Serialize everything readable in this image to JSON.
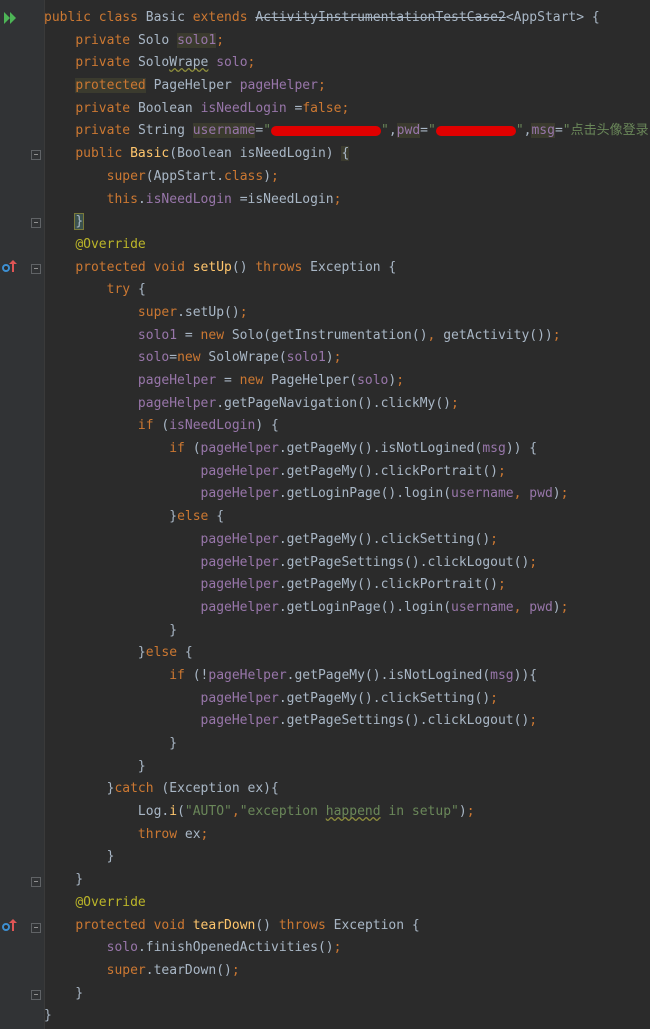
{
  "code_lines": [
    [
      {
        "t": "public ",
        "c": "kw"
      },
      {
        "t": "class ",
        "c": "kw"
      },
      {
        "t": "Basic "
      },
      {
        "t": "extends ",
        "c": "kw"
      },
      {
        "t": "ActivityInstrumentationTestCase2",
        "c": "strike"
      },
      {
        "t": "<AppStart> {"
      }
    ],
    [
      {
        "t": "    "
      },
      {
        "t": "private ",
        "c": "kw"
      },
      {
        "t": "Solo "
      },
      {
        "t": "solo1",
        "c": "fld hl"
      },
      {
        "t": ";",
        "c": "kw"
      }
    ],
    [
      {
        "t": "    "
      },
      {
        "t": "private ",
        "c": "kw"
      },
      {
        "t": "Solo"
      },
      {
        "t": "Wrape",
        "c": "warn"
      },
      {
        "t": " "
      },
      {
        "t": "solo",
        "c": "fld"
      },
      {
        "t": ";",
        "c": "kw"
      }
    ],
    [
      {
        "t": "    "
      },
      {
        "t": "protected",
        "c": "kw hl"
      },
      {
        "t": " PageHelper "
      },
      {
        "t": "pageHelper",
        "c": "fld"
      },
      {
        "t": ";",
        "c": "kw"
      }
    ],
    [
      {
        "t": "    "
      },
      {
        "t": "private ",
        "c": "kw"
      },
      {
        "t": "Boolean "
      },
      {
        "t": "isNeedLogin ",
        "c": "fld"
      },
      {
        "t": "="
      },
      {
        "t": "false",
        "c": "kw"
      },
      {
        "t": ";",
        "c": "kw"
      }
    ],
    [
      {
        "t": "    "
      },
      {
        "t": "private ",
        "c": "kw"
      },
      {
        "t": "String "
      },
      {
        "t": "username",
        "c": "fld hl"
      },
      {
        "t": "="
      },
      {
        "t": "\"",
        "c": "str"
      },
      {
        "blur": 110
      },
      {
        "t": "\"",
        "c": "str"
      },
      {
        "t": ","
      },
      {
        "t": "pwd",
        "c": "fld hl"
      },
      {
        "t": "="
      },
      {
        "t": "\"",
        "c": "str"
      },
      {
        "blur": 80
      },
      {
        "t": "\"",
        "c": "str"
      },
      {
        "t": ","
      },
      {
        "t": "msg",
        "c": "fld hl"
      },
      {
        "t": "="
      },
      {
        "t": "\"点击头像登录\"",
        "c": "str"
      },
      {
        "t": ";",
        "c": "kw"
      }
    ],
    [
      {
        "t": "    "
      },
      {
        "t": "public ",
        "c": "kw"
      },
      {
        "t": "Basic",
        "c": "fn"
      },
      {
        "t": "(Boolean isNeedLogin) "
      },
      {
        "t": "{",
        "c": "hl"
      }
    ],
    [
      {
        "t": "        "
      },
      {
        "t": "super",
        "c": "kw"
      },
      {
        "t": "(AppStart."
      },
      {
        "t": "class",
        "c": "kw"
      },
      {
        "t": ")"
      },
      {
        "t": ";",
        "c": "kw"
      }
    ],
    [
      {
        "t": "        "
      },
      {
        "t": "this",
        "c": "kw"
      },
      {
        "t": "."
      },
      {
        "t": "isNeedLogin ",
        "c": "fld"
      },
      {
        "t": "=isNeedLogin"
      },
      {
        "t": ";",
        "c": "kw"
      }
    ],
    [
      {
        "t": "    "
      },
      {
        "t": "}",
        "c": "brace-hl"
      }
    ],
    [
      {
        "t": "    "
      },
      {
        "t": "@Override",
        "c": "ann"
      }
    ],
    [
      {
        "t": "    "
      },
      {
        "t": "protected ",
        "c": "kw"
      },
      {
        "t": "void ",
        "c": "kw"
      },
      {
        "t": "setUp",
        "c": "fn"
      },
      {
        "t": "() "
      },
      {
        "t": "throws ",
        "c": "kw"
      },
      {
        "t": "Exception {"
      }
    ],
    [
      {
        "t": "        "
      },
      {
        "t": "try ",
        "c": "kw"
      },
      {
        "t": "{"
      }
    ],
    [
      {
        "t": "            "
      },
      {
        "t": "super",
        "c": "kw"
      },
      {
        "t": ".setUp()"
      },
      {
        "t": ";",
        "c": "kw"
      }
    ],
    [
      {
        "t": "            "
      },
      {
        "t": "solo1 ",
        "c": "fld"
      },
      {
        "t": "= "
      },
      {
        "t": "new ",
        "c": "kw"
      },
      {
        "t": "Solo(getInstrumentation()"
      },
      {
        "t": ", ",
        "c": "kw"
      },
      {
        "t": "getActivity())"
      },
      {
        "t": ";",
        "c": "kw"
      }
    ],
    [
      {
        "t": "            "
      },
      {
        "t": "solo",
        "c": "fld"
      },
      {
        "t": "="
      },
      {
        "t": "new ",
        "c": "kw"
      },
      {
        "t": "SoloWrape("
      },
      {
        "t": "solo1",
        "c": "fld"
      },
      {
        "t": ")"
      },
      {
        "t": ";",
        "c": "kw"
      }
    ],
    [
      {
        "t": "            "
      },
      {
        "t": "pageHelper ",
        "c": "fld"
      },
      {
        "t": "= "
      },
      {
        "t": "new ",
        "c": "kw"
      },
      {
        "t": "PageHelper("
      },
      {
        "t": "solo",
        "c": "fld"
      },
      {
        "t": ")"
      },
      {
        "t": ";",
        "c": "kw"
      }
    ],
    [
      {
        "t": "            "
      },
      {
        "t": "pageHelper",
        "c": "fld"
      },
      {
        "t": ".getPageNavigation().clickMy()"
      },
      {
        "t": ";",
        "c": "kw"
      }
    ],
    [
      {
        "t": "            "
      },
      {
        "t": "if ",
        "c": "kw"
      },
      {
        "t": "("
      },
      {
        "t": "isNeedLogin",
        "c": "fld"
      },
      {
        "t": ") {"
      }
    ],
    [
      {
        "t": "                "
      },
      {
        "t": "if ",
        "c": "kw"
      },
      {
        "t": "("
      },
      {
        "t": "pageHelper",
        "c": "fld"
      },
      {
        "t": ".getPageMy().isNotLogined("
      },
      {
        "t": "msg",
        "c": "fld"
      },
      {
        "t": ")) {"
      }
    ],
    [
      {
        "t": "                    "
      },
      {
        "t": "pageHelper",
        "c": "fld"
      },
      {
        "t": ".getPageMy().clickPortrait()"
      },
      {
        "t": ";",
        "c": "kw"
      }
    ],
    [
      {
        "t": "                    "
      },
      {
        "t": "pageHelper",
        "c": "fld"
      },
      {
        "t": ".getLoginPage().login("
      },
      {
        "t": "username",
        "c": "fld"
      },
      {
        "t": ", ",
        "c": "kw"
      },
      {
        "t": "pwd",
        "c": "fld"
      },
      {
        "t": ")"
      },
      {
        "t": ";",
        "c": "kw"
      }
    ],
    [
      {
        "t": "                "
      },
      {
        "t": "}"
      },
      {
        "t": "else ",
        "c": "kw"
      },
      {
        "t": "{"
      }
    ],
    [
      {
        "t": "                    "
      },
      {
        "t": "pageHelper",
        "c": "fld"
      },
      {
        "t": ".getPageMy().clickSetting()"
      },
      {
        "t": ";",
        "c": "kw"
      }
    ],
    [
      {
        "t": "                    "
      },
      {
        "t": "pageHelper",
        "c": "fld"
      },
      {
        "t": ".getPageSettings().clickLogout()"
      },
      {
        "t": ";",
        "c": "kw"
      }
    ],
    [
      {
        "t": "                    "
      },
      {
        "t": "pageHelper",
        "c": "fld"
      },
      {
        "t": ".getPageMy().clickPortrait()"
      },
      {
        "t": ";",
        "c": "kw"
      }
    ],
    [
      {
        "t": "                    "
      },
      {
        "t": "pageHelper",
        "c": "fld"
      },
      {
        "t": ".getLoginPage().login("
      },
      {
        "t": "username",
        "c": "fld"
      },
      {
        "t": ", ",
        "c": "kw"
      },
      {
        "t": "pwd",
        "c": "fld"
      },
      {
        "t": ")"
      },
      {
        "t": ";",
        "c": "kw"
      }
    ],
    [
      {
        "t": "                }"
      }
    ],
    [
      {
        "t": "            }"
      },
      {
        "t": "else ",
        "c": "kw"
      },
      {
        "t": "{"
      }
    ],
    [
      {
        "t": "                "
      },
      {
        "t": "if ",
        "c": "kw"
      },
      {
        "t": "(!"
      },
      {
        "t": "pageHelper",
        "c": "fld"
      },
      {
        "t": ".getPageMy().isNotLogined("
      },
      {
        "t": "msg",
        "c": "fld"
      },
      {
        "t": ")){"
      }
    ],
    [
      {
        "t": "                    "
      },
      {
        "t": "pageHelper",
        "c": "fld"
      },
      {
        "t": ".getPageMy().clickSetting()"
      },
      {
        "t": ";",
        "c": "kw"
      }
    ],
    [
      {
        "t": "                    "
      },
      {
        "t": "pageHelper",
        "c": "fld"
      },
      {
        "t": ".getPageSettings().clickLogout()"
      },
      {
        "t": ";",
        "c": "kw"
      }
    ],
    [
      {
        "t": "                }"
      }
    ],
    [
      {
        "t": "            }"
      }
    ],
    [
      {
        "t": "        }"
      },
      {
        "t": "catch ",
        "c": "kw"
      },
      {
        "t": "(Exception ex){"
      }
    ],
    [
      {
        "t": "            "
      },
      {
        "t": "Log."
      },
      {
        "t": "i",
        "c": "fn"
      },
      {
        "t": "("
      },
      {
        "t": "\"AUTO\"",
        "c": "str"
      },
      {
        "t": ",",
        "c": "kw"
      },
      {
        "t": "\"exception ",
        "c": "str"
      },
      {
        "t": "happend",
        "c": "str warn"
      },
      {
        "t": " in setup\"",
        "c": "str"
      },
      {
        "t": ")"
      },
      {
        "t": ";",
        "c": "kw"
      }
    ],
    [
      {
        "t": "            "
      },
      {
        "t": "throw ",
        "c": "kw"
      },
      {
        "t": "ex"
      },
      {
        "t": ";",
        "c": "kw"
      }
    ],
    [
      {
        "t": "        }"
      }
    ],
    [
      {
        "t": "    }"
      }
    ],
    [
      {
        "t": "    "
      },
      {
        "t": "@Override",
        "c": "ann"
      }
    ],
    [
      {
        "t": "    "
      },
      {
        "t": "protected ",
        "c": "kw"
      },
      {
        "t": "void ",
        "c": "kw"
      },
      {
        "t": "tearDown",
        "c": "fn"
      },
      {
        "t": "() "
      },
      {
        "t": "throws ",
        "c": "kw"
      },
      {
        "t": "Exception {"
      }
    ],
    [
      {
        "t": "        "
      },
      {
        "t": "solo",
        "c": "fld"
      },
      {
        "t": ".finishOpenedActivities()"
      },
      {
        "t": ";",
        "c": "kw"
      }
    ],
    [
      {
        "t": "        "
      },
      {
        "t": "super",
        "c": "kw"
      },
      {
        "t": ".tearDown()"
      },
      {
        "t": ";",
        "c": "kw"
      }
    ],
    [
      {
        "t": "    }"
      }
    ],
    [
      {
        "t": "}"
      }
    ]
  ],
  "gutter": {
    "run_icon": "run-test-class-icon",
    "override_icons": [
      "override-method-icon",
      "override-method-icon"
    ],
    "fold_markers": "fold-icon"
  },
  "colors": {
    "background": "#2b2b2b",
    "keyword": "#cc7832",
    "field": "#9876aa",
    "string": "#6a8759",
    "method": "#ffc66d",
    "annotation": "#bbb529",
    "text": "#a9b7c6"
  }
}
